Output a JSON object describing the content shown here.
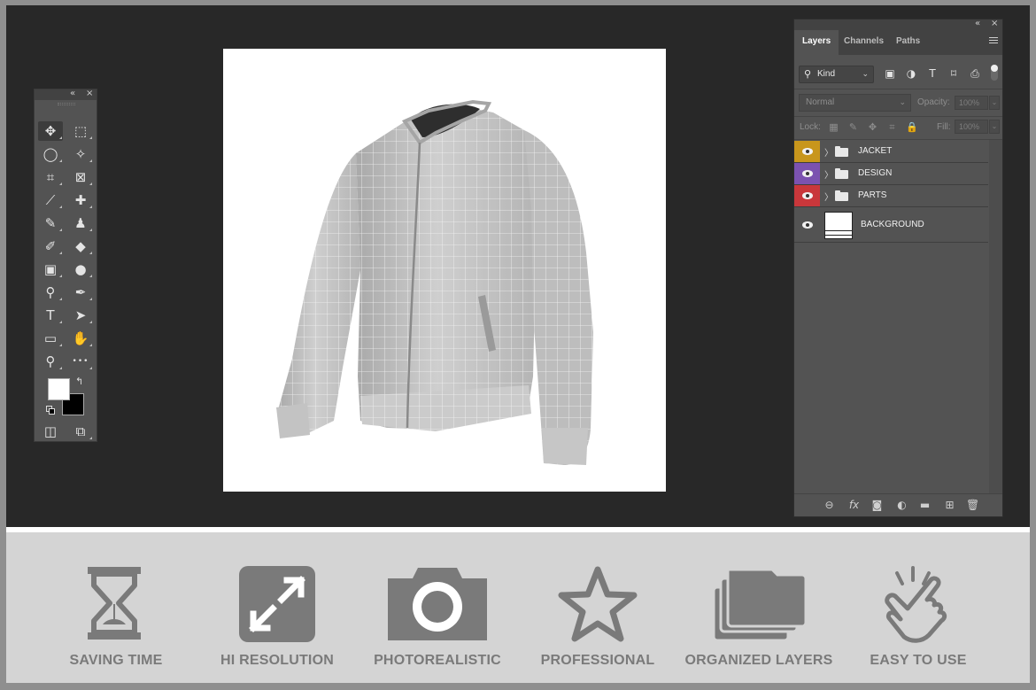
{
  "window": {
    "collapse_glyph": "«",
    "close_glyph": "×"
  },
  "toolbar": {
    "tools": [
      {
        "name": "move-tool",
        "icon": "move-icon",
        "glyph": "✥"
      },
      {
        "name": "marquee-tool",
        "icon": "marquee-icon",
        "glyph": "⬚"
      },
      {
        "name": "lasso-tool",
        "icon": "lasso-icon",
        "glyph": "◯"
      },
      {
        "name": "magic-wand-tool",
        "icon": "magic-wand-icon",
        "glyph": "✧"
      },
      {
        "name": "crop-tool",
        "icon": "crop-icon",
        "glyph": "⌗"
      },
      {
        "name": "frame-tool",
        "icon": "frame-icon",
        "glyph": "⊠"
      },
      {
        "name": "eyedropper-tool",
        "icon": "eyedropper-icon",
        "glyph": "⟋"
      },
      {
        "name": "healing-brush-tool",
        "icon": "bandage-icon",
        "glyph": "✚"
      },
      {
        "name": "brush-tool",
        "icon": "brush-icon",
        "glyph": "✎"
      },
      {
        "name": "stamp-tool",
        "icon": "stamp-icon",
        "glyph": "♟"
      },
      {
        "name": "history-brush-tool",
        "icon": "history-brush-icon",
        "glyph": "✐"
      },
      {
        "name": "eraser-tool",
        "icon": "eraser-icon",
        "glyph": "◆"
      },
      {
        "name": "gradient-tool",
        "icon": "gradient-icon",
        "glyph": "▣"
      },
      {
        "name": "blur-tool",
        "icon": "drop-icon",
        "glyph": "●"
      },
      {
        "name": "dodge-tool",
        "icon": "dodge-icon",
        "glyph": "⚲"
      },
      {
        "name": "pen-tool",
        "icon": "pen-icon",
        "glyph": "✒"
      },
      {
        "name": "type-tool",
        "icon": "type-icon",
        "glyph": "T"
      },
      {
        "name": "path-select-tool",
        "icon": "arrow-cursor-icon",
        "glyph": "➤"
      },
      {
        "name": "rectangle-tool",
        "icon": "rectangle-icon",
        "glyph": "▭"
      },
      {
        "name": "hand-tool",
        "icon": "hand-icon",
        "glyph": "✋"
      },
      {
        "name": "zoom-tool",
        "icon": "zoom-icon",
        "glyph": "⚲"
      },
      {
        "name": "more-tools",
        "icon": "ellipsis-icon",
        "glyph": "•••"
      }
    ],
    "swap_glyph": "↰",
    "quick_mask_glyph": "◫",
    "screen_mode_glyph": "⧉",
    "foreground_color": "#ffffff",
    "background_color": "#000000"
  },
  "layers_panel": {
    "tabs": [
      "Layers",
      "Channels",
      "Paths"
    ],
    "active_tab": "Layers",
    "kind_label": "Kind",
    "search_glyph": "⚲",
    "chevron_glyph": "⌄",
    "filter_glyphs": [
      "▣",
      "◑",
      "T",
      "⌑",
      "⎙"
    ],
    "blend_mode": "Normal",
    "opacity_label": "Opacity:",
    "opacity_value": "100%",
    "lock_label": "Lock:",
    "lock_glyphs": [
      "▦",
      "✎",
      "✥",
      "⌗",
      "🔒"
    ],
    "fill_label": "Fill:",
    "fill_value": "100%",
    "expand_glyph": "〉",
    "layers": [
      {
        "name": "JACKET",
        "type": "group",
        "color": "#c8961c"
      },
      {
        "name": "DESIGN",
        "type": "group",
        "color": "#7b52b0"
      },
      {
        "name": "PARTS",
        "type": "group",
        "color": "#c9373b"
      },
      {
        "name": "BACKGROUND",
        "type": "layer",
        "color": null
      }
    ],
    "bottom_glyphs": [
      "⊖",
      "fx",
      "◙",
      "◐",
      "▬",
      "⊞",
      "🗑"
    ]
  },
  "features": [
    {
      "label": "SAVING TIME",
      "icon": "hourglass-icon"
    },
    {
      "label": "HI RESOLUTION",
      "icon": "expand-arrows-icon"
    },
    {
      "label": "PHOTOREALISTIC",
      "icon": "camera-icon"
    },
    {
      "label": "PROFESSIONAL",
      "icon": "star-icon"
    },
    {
      "label": "ORGANIZED LAYERS",
      "icon": "stacked-folders-icon"
    },
    {
      "label": "EASY TO USE",
      "icon": "tap-hand-icon"
    }
  ],
  "colors": {
    "workspace": "#282828",
    "panel": "#535353",
    "feature_icon": "#7a7a7a"
  }
}
